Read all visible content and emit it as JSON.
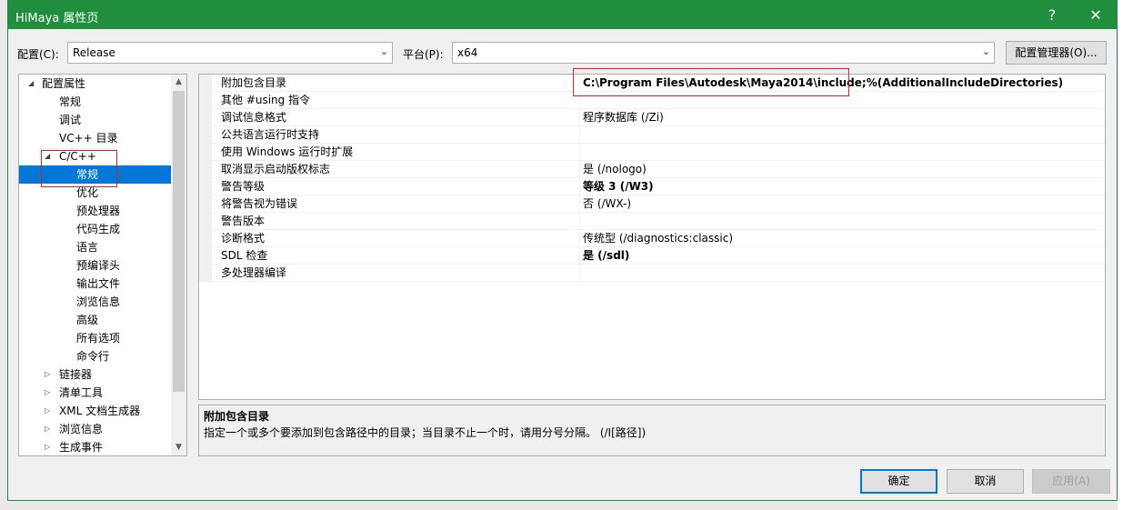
{
  "window": {
    "title": "HiMaya 属性页",
    "help_label": "?",
    "close_label": "✕"
  },
  "config": {
    "config_label": "配置(C):",
    "config_value": "Release",
    "platform_label": "平台(P):",
    "platform_value": "x64",
    "manager_button": "配置管理器(O)..."
  },
  "tree": {
    "items": [
      {
        "label": "配置属性",
        "expander": "◢"
      },
      {
        "label": "常规"
      },
      {
        "label": "调试"
      },
      {
        "label": "VC++ 目录"
      },
      {
        "label": "C/C++",
        "expander": "◢"
      },
      {
        "label": "常规"
      },
      {
        "label": "优化"
      },
      {
        "label": "预处理器"
      },
      {
        "label": "代码生成"
      },
      {
        "label": "语言"
      },
      {
        "label": "预编译头"
      },
      {
        "label": "输出文件"
      },
      {
        "label": "浏览信息"
      },
      {
        "label": "高级"
      },
      {
        "label": "所有选项"
      },
      {
        "label": "命令行"
      },
      {
        "label": "链接器",
        "expander": "▷"
      },
      {
        "label": "清单工具",
        "expander": "▷"
      },
      {
        "label": "XML 文档生成器",
        "expander": "▷"
      },
      {
        "label": "浏览信息",
        "expander": "▷"
      },
      {
        "label": "生成事件",
        "expander": "▷"
      }
    ],
    "scroll_up": "▲",
    "scroll_down": "▼"
  },
  "properties": {
    "rows": [
      {
        "name": "附加包含目录",
        "value": "C:\\Program Files\\Autodesk\\Maya2014\\include;%(AdditionalIncludeDirectories)"
      },
      {
        "name": "其他 #using 指令",
        "value": ""
      },
      {
        "name": "调试信息格式",
        "value": "程序数据库 (/Zi)"
      },
      {
        "name": "公共语言运行时支持",
        "value": ""
      },
      {
        "name": "使用 Windows 运行时扩展",
        "value": ""
      },
      {
        "name": "取消显示启动版权标志",
        "value": "是 (/nologo)"
      },
      {
        "name": "警告等级",
        "value": "等级 3 (/W3)"
      },
      {
        "name": "将警告视为错误",
        "value": "否 (/WX-)"
      },
      {
        "name": "警告版本",
        "value": ""
      },
      {
        "name": "诊断格式",
        "value": "传统型 (/diagnostics:classic)"
      },
      {
        "name": "SDL 检查",
        "value": "是 (/sdl)"
      },
      {
        "name": "多处理器编译",
        "value": ""
      }
    ]
  },
  "description": {
    "title": "附加包含目录",
    "text": "指定一个或多个要添加到包含路径中的目录；当目录不止一个时，请用分号分隔。      (/I[路径])"
  },
  "footer": {
    "ok": "确定",
    "cancel": "取消",
    "apply": "应用(A)"
  },
  "colors": {
    "title_bar": "#1f8f3e",
    "selection": "#0078d7",
    "highlight_box": "#e02020"
  }
}
